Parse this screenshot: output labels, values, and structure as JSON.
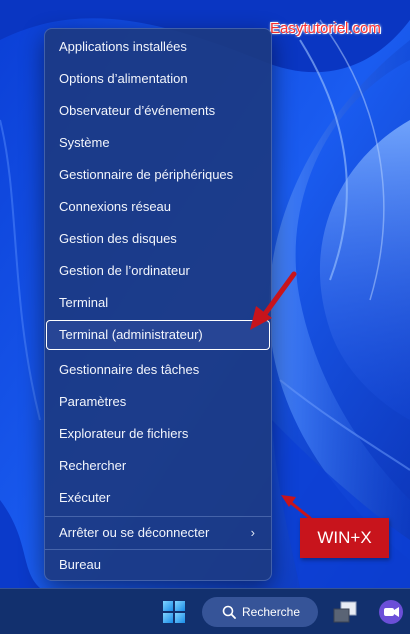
{
  "watermark": "Easytutoriel.com",
  "menu": {
    "items": [
      {
        "label": "Applications installées"
      },
      {
        "label": "Options d’alimentation"
      },
      {
        "label": "Observateur d’événements"
      },
      {
        "label": "Système"
      },
      {
        "label": "Gestionnaire de périphériques"
      },
      {
        "label": "Connexions réseau"
      },
      {
        "label": "Gestion des disques"
      },
      {
        "label": "Gestion de l’ordinateur"
      },
      {
        "label": "Terminal"
      },
      {
        "label": "Terminal (administrateur)"
      },
      {
        "label": "Gestionnaire des tâches"
      },
      {
        "label": "Paramètres"
      },
      {
        "label": "Explorateur de fichiers"
      },
      {
        "label": "Rechercher"
      },
      {
        "label": "Exécuter"
      },
      {
        "label": "Arrêter ou se déconnecter"
      },
      {
        "label": "Bureau"
      }
    ],
    "selected_label": "Terminal (administrateur)",
    "submenu_arrow": "›"
  },
  "annotation": {
    "badge": "WIN+X",
    "color": "#c8141c"
  },
  "taskbar": {
    "search_label": "Recherche",
    "icons": [
      "windows-start-icon",
      "search-icon",
      "task-view-icon",
      "chat-icon"
    ]
  },
  "colors": {
    "wallpaper": "#1550e6",
    "menu_bg": "#1c3a82",
    "watermark": "#ff3131"
  }
}
